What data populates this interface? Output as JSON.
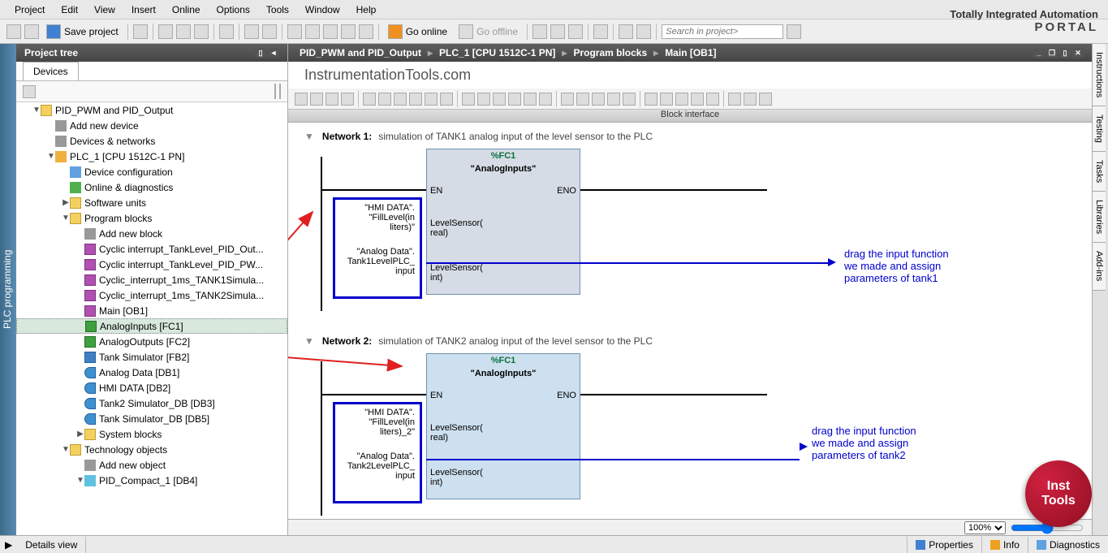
{
  "brand": {
    "line1": "Totally Integrated Automation",
    "line2": "PORTAL"
  },
  "menu": {
    "project": "Project",
    "edit": "Edit",
    "view": "View",
    "insert": "Insert",
    "online": "Online",
    "options": "Options",
    "tools": "Tools",
    "window": "Window",
    "help": "Help"
  },
  "toolbar": {
    "save": "Save project",
    "go_online": "Go online",
    "go_offline": "Go offline",
    "search_placeholder": "Search in project>"
  },
  "left_tab": "PLC programming",
  "project_tree": {
    "title": "Project tree",
    "devices_tab": "Devices"
  },
  "tree": {
    "root": "PID_PWM and PID_Output",
    "add_device": "Add new device",
    "devnet": "Devices & networks",
    "plc": "PLC_1 [CPU 1512C-1 PN]",
    "devconf": "Device configuration",
    "diag": "Online & diagnostics",
    "sw": "Software units",
    "pblocks": "Program blocks",
    "addblock": "Add new block",
    "b1": "Cyclic interrupt_TankLevel_PID_Out...",
    "b2": "Cyclic interrupt_TankLevel_PID_PW...",
    "b3": "Cyclic_interrupt_1ms_TANK1Simula...",
    "b4": "Cyclic_interrupt_1ms_TANK2Simula...",
    "b5": "Main [OB1]",
    "b6": "AnalogInputs [FC1]",
    "b7": "AnalogOutputs [FC2]",
    "b8": "Tank Simulator [FB2]",
    "b9": "Analog Data [DB1]",
    "b10": "HMI DATA [DB2]",
    "b11": "Tank2 Simulator_DB [DB3]",
    "b12": "Tank Simulator_DB [DB5]",
    "b13": "System blocks",
    "tech": "Technology objects",
    "addobj": "Add new object",
    "pid": "PID_Compact_1 [DB4]"
  },
  "breadcrumb": {
    "p1": "PID_PWM and PID_Output",
    "p2": "PLC_1 [CPU 1512C-1 PN]",
    "p3": "Program blocks",
    "p4": "Main [OB1]"
  },
  "watermark": "InstrumentationTools.com",
  "block_interface": "Block interface",
  "network1": {
    "title": "Network 1:",
    "comment": "simulation of TANK1 analog input of the level sensor to the PLC",
    "fc": "%FC1",
    "fname": "\"AnalogInputs\"",
    "en": "EN",
    "eno": "ENO",
    "p1": "LevelSensor(\nreal)",
    "p2": "LevelSensor(\nint)",
    "param1": "\"HMI DATA\".\n\"FillLevel(in\nliters)\"",
    "param2": "\"Analog Data\".\nTank1LevelPLC_\ninput"
  },
  "network2": {
    "title": "Network 2:",
    "comment": "simulation of TANK2 analog input of the level sensor to the PLC",
    "fc": "%FC1",
    "fname": "\"AnalogInputs\"",
    "en": "EN",
    "eno": "ENO",
    "p1": "LevelSensor(\nreal)",
    "p2": "LevelSensor(\nint)",
    "param1": "\"HMI DATA\".\n\"FillLevel(in\nliters)_2\"",
    "param2": "\"Analog Data\".\nTank2LevelPLC_\ninput"
  },
  "annot1": "drag the input function\nwe made and assign\nparameters of tank1",
  "annot2": "drag the input function\nwe made and assign\nparameters of tank2",
  "right_tabs": {
    "t1": "Instructions",
    "t2": "Testing",
    "t3": "Tasks",
    "t4": "Libraries",
    "t5": "Add-ins"
  },
  "zoom": "100%",
  "details": "Details view",
  "props": {
    "p": "Properties",
    "i": "Info",
    "d": "Diagnostics"
  },
  "logo": {
    "l1": "Inst",
    "l2": "Tools"
  }
}
